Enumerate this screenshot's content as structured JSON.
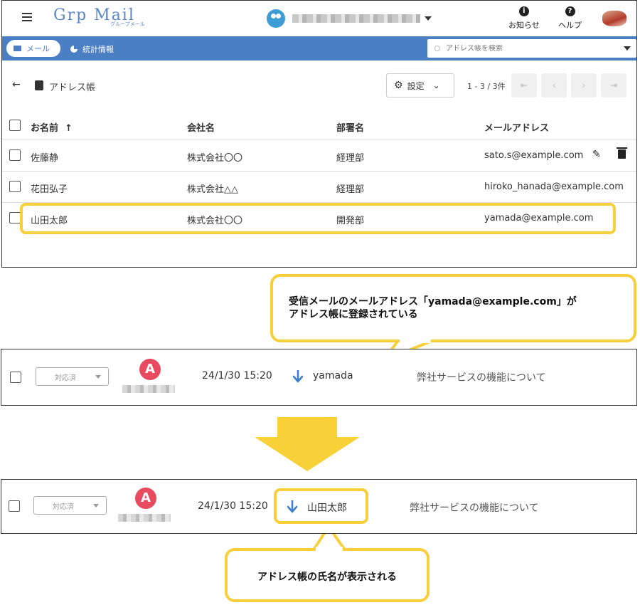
{
  "header": {
    "logo_main": "Grp Mail",
    "logo_sub": "グループメール",
    "notice_label": "お知らせ",
    "help_label": "ヘルプ"
  },
  "nav": {
    "mail_label": "メール",
    "stats_label": "統計情報",
    "search_placeholder": "アドレス帳を検索"
  },
  "toolbar": {
    "breadcrumb": "アドレス帳",
    "settings_label": "設定",
    "pager_text": "1 - 3 / 3件"
  },
  "table": {
    "columns": [
      "お名前",
      "会社名",
      "部署名",
      "メールアドレス"
    ],
    "sort_indicator": "↑",
    "rows": [
      {
        "name": "佐藤静",
        "company": "株式会社〇〇",
        "dept": "経理部",
        "email": "sato.s@example.com"
      },
      {
        "name": "花田弘子",
        "company": "株式会社△△",
        "dept": "経理部",
        "email": "hiroko_hanada@example.com"
      },
      {
        "name": "山田太郎",
        "company": "株式会社〇〇",
        "dept": "開発部",
        "email": "yamada@example.com"
      }
    ]
  },
  "callout1": {
    "line1": "受信メールのメールアドレス「yamada@example.com」が",
    "line2": "アドレス帳に登録されている"
  },
  "mail_before": {
    "status": "対応済",
    "avatar_letter": "A",
    "time": "24/1/30 15:20",
    "from": "yamada",
    "subject": "弊社サービスの機能について"
  },
  "mail_after": {
    "status": "対応済",
    "avatar_letter": "A",
    "time": "24/1/30 15:20",
    "from": "山田太郎",
    "subject": "弊社サービスの機能について"
  },
  "callout2": {
    "text": "アドレス帳の氏名が表示される"
  },
  "colors": {
    "brand_blue": "#4b7fc4",
    "highlight_yellow": "#f6cf3a",
    "avatar_red": "#e84a5f",
    "arrow_blue": "#3d7fd0"
  }
}
